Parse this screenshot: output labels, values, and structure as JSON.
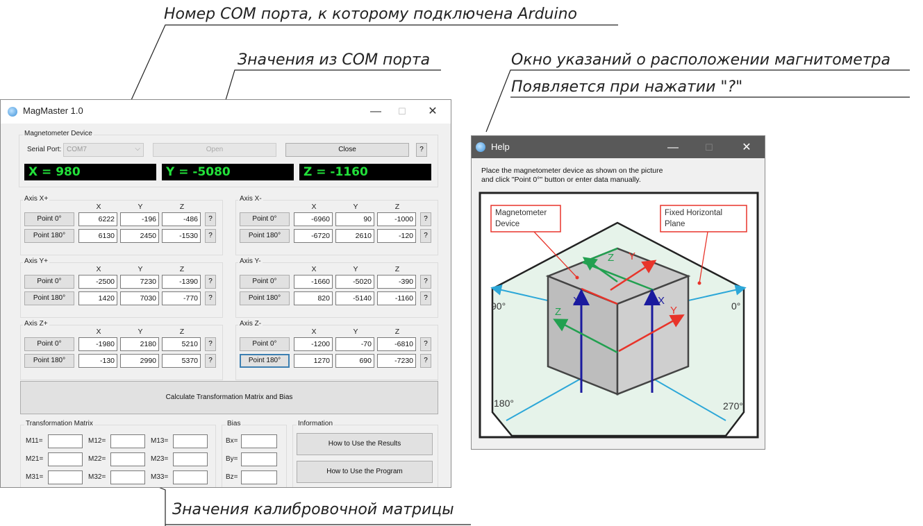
{
  "annotations": {
    "com_port": "Номер COM порта, к которому подключена Arduino",
    "com_values": "Значения из COM порта",
    "help_window_line1": "Окно указаний о расположении магнитометра",
    "help_window_line2": "Появляется при нажатии \"?\"",
    "matrix_values": "Значения калибровочной матрицы"
  },
  "main_window": {
    "title": "MagMaster 1.0",
    "minimize": "—",
    "maximize": "☐",
    "close": "✕",
    "device_group": "Magnetometer Device",
    "serial_port_label": "Serial Port:",
    "serial_port_value": "COM7",
    "open_button": "Open",
    "close_button": "Close",
    "help_button": "?",
    "x_readout": "X = 980",
    "y_readout": "Y = -5080",
    "z_readout": "Z = -1160",
    "col_x": "X",
    "col_y": "Y",
    "col_z": "Z",
    "point0_label": "Point 0°",
    "point180_label": "Point 180°",
    "axes": [
      {
        "title": "Axis X+",
        "p0": [
          "6222",
          "-196",
          "-486"
        ],
        "p180": [
          "6130",
          "2450",
          "-1530"
        ]
      },
      {
        "title": "Axis X-",
        "p0": [
          "-6960",
          "90",
          "-1000"
        ],
        "p180": [
          "-6720",
          "2610",
          "-120"
        ]
      },
      {
        "title": "Axis Y+",
        "p0": [
          "-2500",
          "7230",
          "-1390"
        ],
        "p180": [
          "1420",
          "7030",
          "-770"
        ]
      },
      {
        "title": "Axis Y-",
        "p0": [
          "-1660",
          "-5020",
          "-390"
        ],
        "p180": [
          "820",
          "-5140",
          "-1160"
        ]
      },
      {
        "title": "Axis Z+",
        "p0": [
          "-1980",
          "2180",
          "5210"
        ],
        "p180": [
          "-130",
          "2990",
          "5370"
        ]
      },
      {
        "title": "Axis Z-",
        "p0": [
          "-1200",
          "-70",
          "-6810"
        ],
        "p180": [
          "1270",
          "690",
          "-7230"
        ]
      }
    ],
    "calculate_button": "Calculate Transformation Matrix and Bias",
    "matrix_group": "Transformation Matrix",
    "matrix_labels": [
      "M11=",
      "M12=",
      "M13=",
      "M21=",
      "M22=",
      "M23=",
      "M31=",
      "M32=",
      "M33="
    ],
    "bias_group": "Bias",
    "bias_labels": [
      "Bx=",
      "By=",
      "Bz="
    ],
    "info_group": "Information",
    "how_results_button": "How to Use the Results",
    "how_program_button": "How to Use the Program"
  },
  "help_window": {
    "title": "Help",
    "minimize": "—",
    "maximize": "☐",
    "close": "✕",
    "instruction_line1": "Place the magnetometer device as shown on the picture",
    "instruction_line2": "and click \"Point 0°\" button or enter data manually.",
    "callout_device_1": "Magnetometer",
    "callout_device_2": "Device",
    "callout_plane_1": "Fixed Horizontal",
    "callout_plane_2": "Plane",
    "angle_90": "90°",
    "angle_0": "0°",
    "angle_180": "180°",
    "angle_270": "270°",
    "axis_x": "X",
    "axis_y": "Y",
    "axis_z": "Z"
  }
}
